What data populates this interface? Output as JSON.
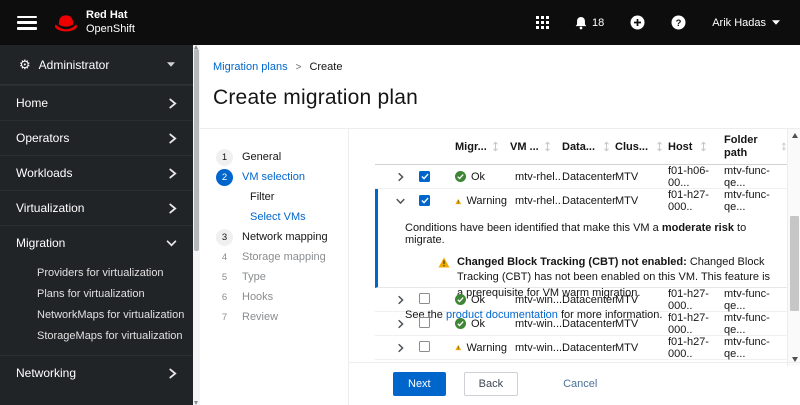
{
  "masthead": {
    "brand_line1": "Red Hat",
    "brand_line2": "OpenShift",
    "notification_count": "18",
    "user_name": "Arik Hadas"
  },
  "sidebar": {
    "perspective_label": "Administrator",
    "items": [
      {
        "label": "Home"
      },
      {
        "label": "Operators"
      },
      {
        "label": "Workloads"
      },
      {
        "label": "Virtualization"
      },
      {
        "label": "Migration"
      },
      {
        "label": "Networking"
      }
    ],
    "migration_children": [
      {
        "label": "Providers for virtualization"
      },
      {
        "label": "Plans for virtualization"
      },
      {
        "label": "NetworkMaps for virtualization"
      },
      {
        "label": "StorageMaps for virtualization"
      }
    ]
  },
  "breadcrumb": {
    "parent": "Migration plans",
    "separator": ">",
    "current": "Create"
  },
  "page": {
    "title": "Create migration plan"
  },
  "wizard": {
    "steps": [
      {
        "num": "1",
        "label": "General"
      },
      {
        "num": "2",
        "label": "VM selection"
      },
      {
        "label": "Filter"
      },
      {
        "label": "Select VMs"
      },
      {
        "num": "3",
        "label": "Network mapping"
      },
      {
        "num": "4",
        "label": "Storage mapping"
      },
      {
        "num": "5",
        "label": "Type"
      },
      {
        "num": "6",
        "label": "Hooks"
      },
      {
        "num": "7",
        "label": "Review"
      }
    ]
  },
  "table": {
    "columns": [
      {
        "label": "Migr..."
      },
      {
        "label": "VM ..."
      },
      {
        "label": "Data..."
      },
      {
        "label": "Clus..."
      },
      {
        "label": "Host"
      },
      {
        "label": "Folder path"
      }
    ],
    "rows": [
      {
        "checked": true,
        "status": "Ok",
        "vm_state_icon": "sync-icon",
        "vm": "mtv-rhel...",
        "datacenter": "Datacenter",
        "cluster": "MTV",
        "host": "f01-h06-00...",
        "folder": "mtv-func-qe..."
      },
      {
        "checked": true,
        "status": "Warning",
        "vm_state_icon": "power-icon",
        "vm": "mtv-rhel...",
        "datacenter": "Datacenter",
        "cluster": "MTV",
        "host": "f01-h27-000..",
        "folder": "mtv-func-qe..."
      },
      {
        "checked": false,
        "status": "Ok",
        "vm_state_icon": "power-icon",
        "vm": "mtv-win...",
        "datacenter": "Datacenter",
        "cluster": "MTV",
        "host": "f01-h27-000..",
        "folder": "mtv-func-qe..."
      },
      {
        "checked": false,
        "status": "Ok",
        "vm_state_icon": "power-icon",
        "vm": "mtv-win...",
        "datacenter": "Datacenter",
        "cluster": "MTV",
        "host": "f01-h27-000..",
        "folder": "mtv-func-qe..."
      },
      {
        "checked": false,
        "status": "Warning",
        "vm_state_icon": "power-icon",
        "vm": "mtv-win...",
        "datacenter": "Datacenter",
        "cluster": "MTV",
        "host": "f01-h27-000..",
        "folder": "mtv-func-qe..."
      }
    ]
  },
  "risk_panel": {
    "intro_prefix": "Conditions have been identified that make this VM a ",
    "intro_bold": "moderate risk",
    "intro_suffix": " to migrate.",
    "warning_bold": "Changed Block Tracking (CBT) not enabled:",
    "warning_rest": " Changed Block Tracking (CBT) has not been enabled on this VM. This feature is a prerequisite for VM warm migration.",
    "see_prefix": "See the ",
    "see_link": "product documentation",
    "see_suffix": " for more information."
  },
  "footer": {
    "next_label": "Next",
    "back_label": "Back",
    "cancel_label": "Cancel"
  },
  "colors": {
    "accent": "#0066cc",
    "ok_green": "#3e8635",
    "warning_yellow": "#f0ab00"
  }
}
